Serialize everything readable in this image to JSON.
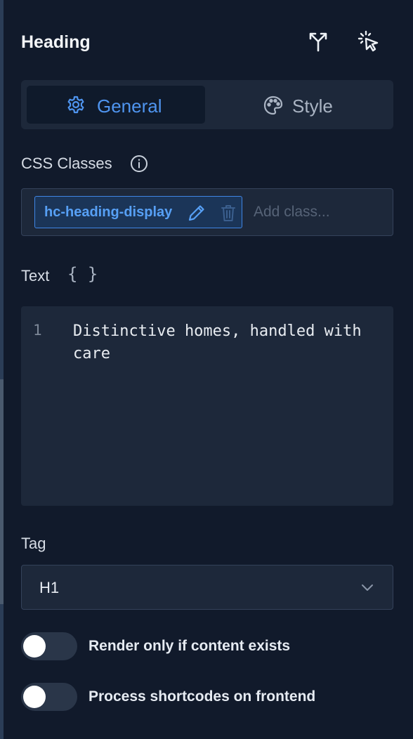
{
  "header": {
    "title": "Heading",
    "icons": [
      "branch-icon",
      "pointer-click-icon"
    ]
  },
  "tabs": [
    {
      "label": "General",
      "icon": "gear-icon",
      "active": true
    },
    {
      "label": "Style",
      "icon": "palette-icon",
      "active": false
    }
  ],
  "css_classes": {
    "label": "CSS Classes",
    "chip": "hc-heading-display",
    "placeholder": "Add class..."
  },
  "text": {
    "label": "Text",
    "braces": "{ }",
    "line_number": "1",
    "content": "Distinctive homes, handled with care"
  },
  "tag": {
    "label": "Tag",
    "value": "H1"
  },
  "toggles": [
    {
      "label": "Render only if content exists",
      "on": false
    },
    {
      "label": "Process shortcodes on frontend",
      "on": false
    }
  ],
  "colors": {
    "accent": "#4f95f0",
    "panel": "#111a2b",
    "field": "#1d283a"
  }
}
